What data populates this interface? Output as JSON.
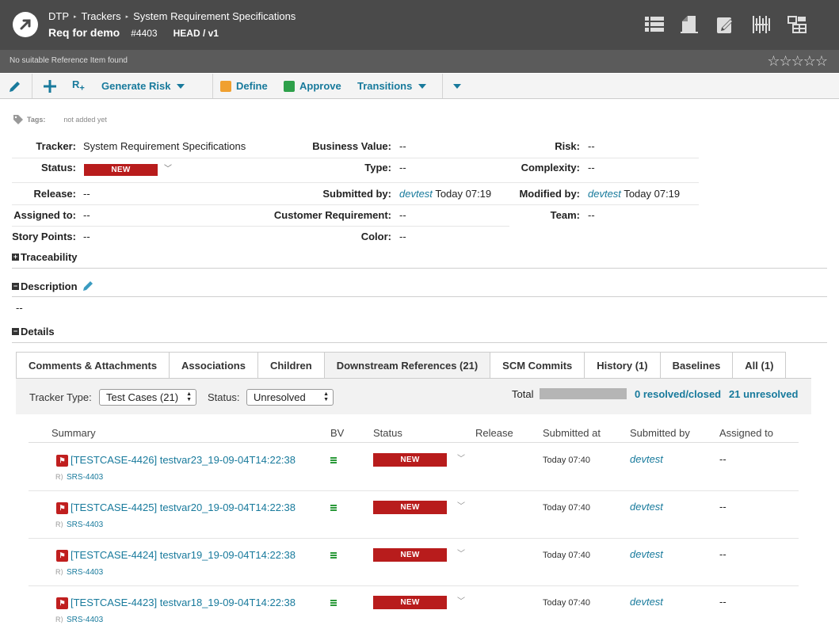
{
  "breadcrumb": {
    "project": "DTP",
    "trackers": "Trackers",
    "tracker": "System Requirement Specifications"
  },
  "item": {
    "title": "Req for demo",
    "id": "#4403",
    "version": "HEAD / v1"
  },
  "subbar": {
    "note": "No suitable Reference Item found",
    "stars": "☆☆☆☆☆"
  },
  "toolbar": {
    "generate_risk": "Generate Risk",
    "define": "Define",
    "approve": "Approve",
    "transitions": "Transitions",
    "add_ref": "R"
  },
  "tags": {
    "label": "Tags:",
    "value": "not added yet"
  },
  "fields": {
    "tracker_label": "Tracker:",
    "tracker": "System Requirement Specifications",
    "status_label": "Status:",
    "status": "NEW",
    "release_label": "Release:",
    "release": "--",
    "assigned_label": "Assigned to:",
    "assigned": "--",
    "story_label": "Story Points:",
    "story": "--",
    "bv_label": "Business Value:",
    "bv": "--",
    "type_label": "Type:",
    "type": "--",
    "submitted_label": "Submitted by:",
    "submitted_user": "devtest",
    "submitted_time": "Today 07:19",
    "customer_label": "Customer Requirement:",
    "customer": "--",
    "color_label": "Color:",
    "color": "--",
    "risk_label": "Risk:",
    "risk": "--",
    "complexity_label": "Complexity:",
    "complexity": "--",
    "modified_label": "Modified by:",
    "modified_user": "devtest",
    "modified_time": "Today 07:19",
    "team_label": "Team:",
    "team": "--"
  },
  "sections": {
    "traceability": "Traceability",
    "description": "Description",
    "description_value": "--",
    "details": "Details"
  },
  "tabs": [
    {
      "label": "Comments & Attachments"
    },
    {
      "label": "Associations"
    },
    {
      "label": "Children"
    },
    {
      "label": "Downstream References (21)"
    },
    {
      "label": "SCM Commits"
    },
    {
      "label": "History (1)"
    },
    {
      "label": "Baselines"
    },
    {
      "label": "All (1)"
    }
  ],
  "filter": {
    "tracker_type_label": "Tracker Type:",
    "tracker_type": "Test Cases (21)",
    "status_label": "Status:",
    "status": "Unresolved",
    "total_label": "Total",
    "resolved": "0 resolved/closed",
    "unresolved": "21 unresolved"
  },
  "table": {
    "columns": [
      "Summary",
      "BV",
      "Status",
      "Release",
      "Submitted at",
      "Submitted by",
      "Assigned to"
    ],
    "rows": [
      {
        "title": "[TESTCASE-4426]  testvar23_19-09-04T14:22:38",
        "ref": "SRS-4403",
        "status": "NEW",
        "submitted_at": "Today 07:40",
        "submitted_by": "devtest",
        "assigned": "--"
      },
      {
        "title": "[TESTCASE-4425]  testvar20_19-09-04T14:22:38",
        "ref": "SRS-4403",
        "status": "NEW",
        "submitted_at": "Today 07:40",
        "submitted_by": "devtest",
        "assigned": "--"
      },
      {
        "title": "[TESTCASE-4424]  testvar19_19-09-04T14:22:38",
        "ref": "SRS-4403",
        "status": "NEW",
        "submitted_at": "Today 07:40",
        "submitted_by": "devtest",
        "assigned": "--"
      },
      {
        "title": "[TESTCASE-4423]  testvar18_19-09-04T14:22:38",
        "ref": "SRS-4403",
        "status": "NEW",
        "submitted_at": "Today 07:40",
        "submitted_by": "devtest",
        "assigned": "--"
      }
    ]
  },
  "colors": {
    "header": "#4a4a4a",
    "accent": "#187a9c",
    "status_new": "#b81c1c"
  }
}
